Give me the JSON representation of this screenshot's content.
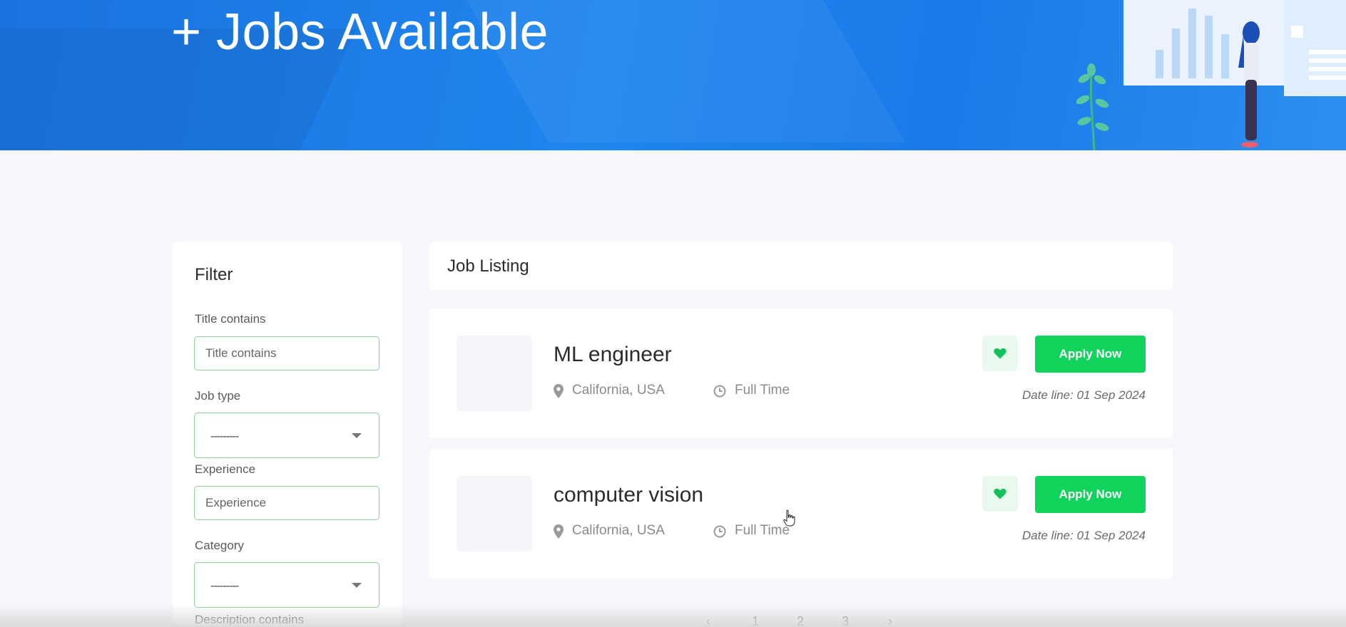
{
  "hero": {
    "title": "+ Jobs Available"
  },
  "filter": {
    "title": "Filter",
    "fields": [
      {
        "label": "Title contains",
        "placeholder": "Title contains"
      },
      {
        "label": "Job type",
        "value": "---------"
      },
      {
        "label": "Experience",
        "placeholder": "Experience"
      },
      {
        "label": "Category",
        "value": "---------"
      },
      {
        "label": "Description contains"
      }
    ]
  },
  "listing": {
    "header": "Job Listing",
    "jobs": [
      {
        "title": "ML engineer",
        "location": "California, USA",
        "type": "Full Time",
        "apply_label": "Apply Now",
        "deadline": "Date line: 01 Sep 2024"
      },
      {
        "title": "computer vision",
        "location": "California, USA",
        "type": "Full Time",
        "apply_label": "Apply Now",
        "deadline": "Date line: 01 Sep 2024"
      }
    ]
  },
  "pagination": {
    "prev": "‹",
    "pages": [
      "1",
      "2",
      "3"
    ],
    "next": "›"
  },
  "colors": {
    "hero_blue": "#1a7ae9",
    "apply_green": "#10d35b",
    "heart_green": "#10c257",
    "input_border": "#8fcf98",
    "page_bg": "#f5f7fb"
  }
}
